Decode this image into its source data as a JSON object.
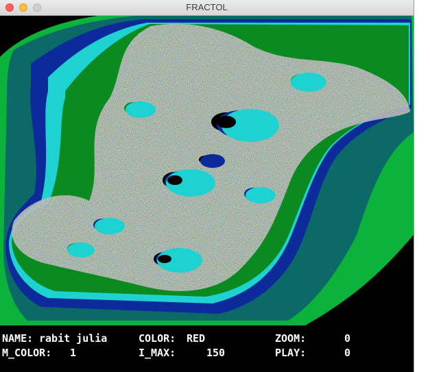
{
  "window": {
    "title": "FRACTOL"
  },
  "colors": {
    "outer_green": "#0bb33a",
    "teal": "#0b6a67",
    "navy": "#0d2a9a",
    "cyan": "#1dd2d0",
    "dark_green": "#0a8a1f",
    "noise_gray": "#6c7b7c",
    "black": "#000000"
  },
  "fractal": {
    "name": "rabit julia"
  },
  "status": {
    "row1": {
      "name_label": "NAME:",
      "name_value": "rabit julia",
      "color_label": "COLOR:",
      "color_value": "RED",
      "zoom_label": "ZOOM:",
      "zoom_value": "0"
    },
    "row2": {
      "m_color_label": "M_COLOR:",
      "m_color_value": "1",
      "i_max_label": "I_MAX:",
      "i_max_value": "150",
      "play_label": "PLAY:",
      "play_value": "0"
    }
  }
}
